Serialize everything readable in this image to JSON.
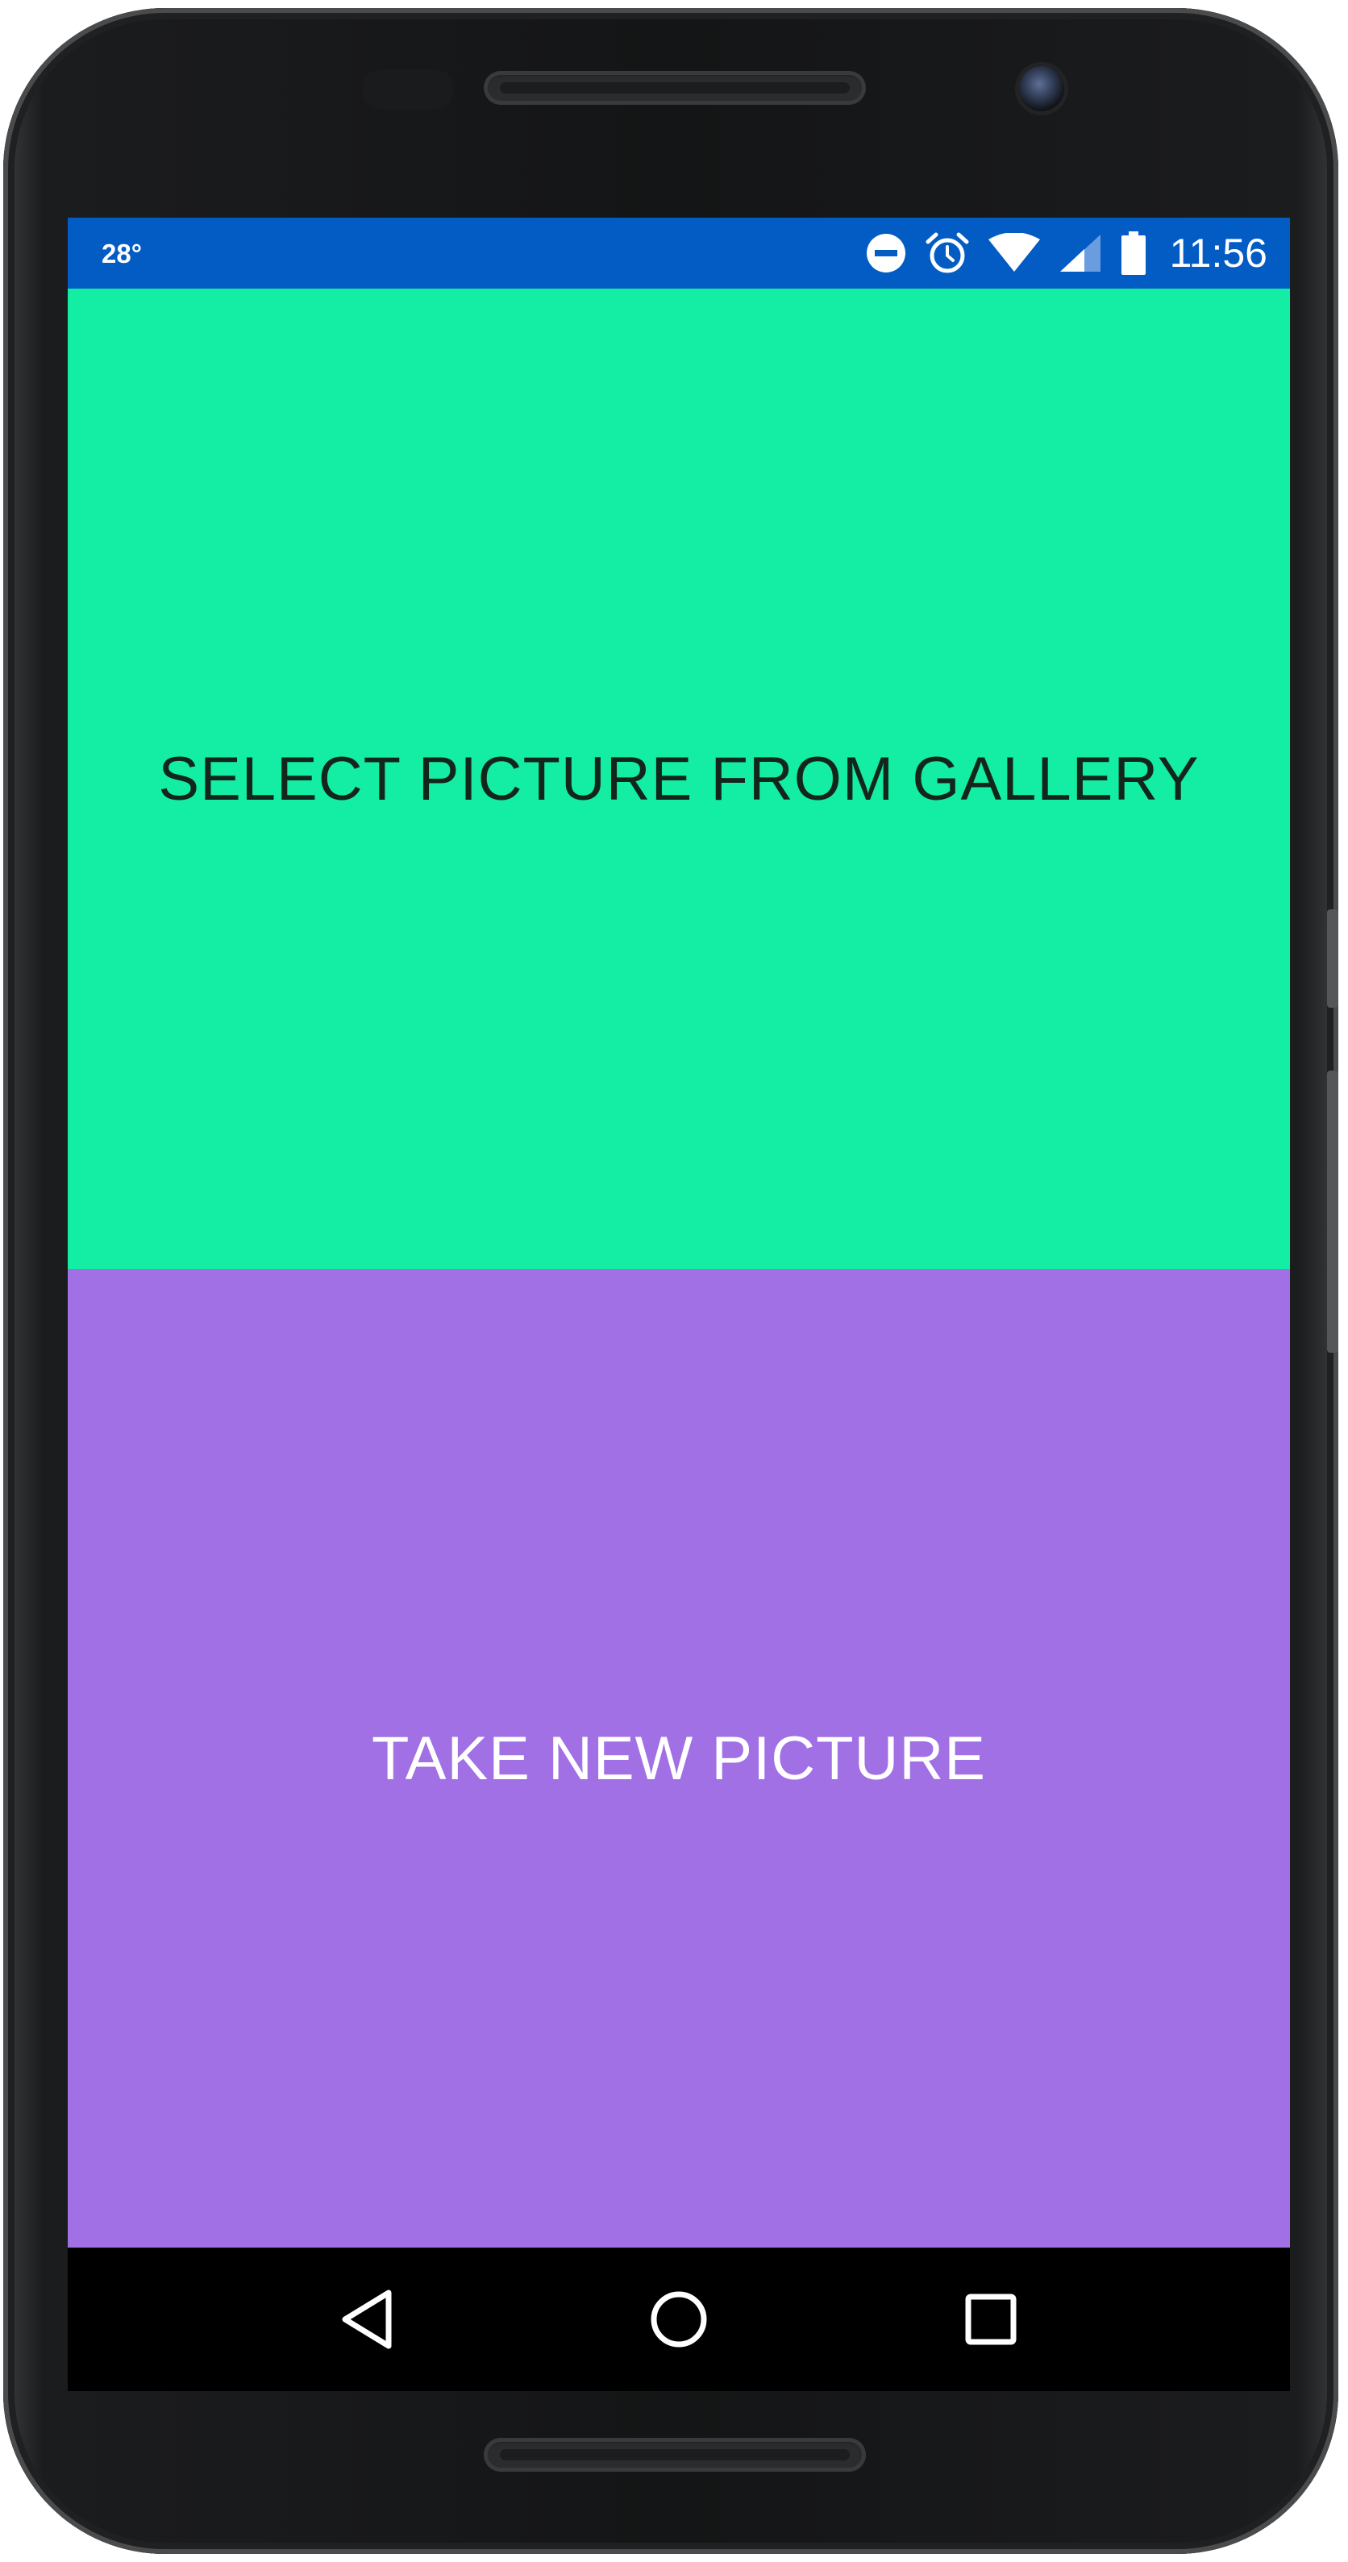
{
  "colors": {
    "status_bar": "#035bc4",
    "gallery_button_bg": "#14eda4",
    "camera_button_bg": "#a070e4",
    "nav_bar": "#000000"
  },
  "status_bar": {
    "temperature": "28°",
    "icons": [
      "do-not-disturb-icon",
      "alarm-icon",
      "wifi-icon",
      "cellular-signal-icon",
      "battery-icon"
    ],
    "time": "11:56"
  },
  "main": {
    "gallery_button_label": "SELECT PICTURE FROM GALLERY",
    "camera_button_label": "TAKE NEW PICTURE"
  },
  "nav_bar": {
    "icons": [
      "back-icon",
      "home-icon",
      "recents-icon"
    ]
  }
}
